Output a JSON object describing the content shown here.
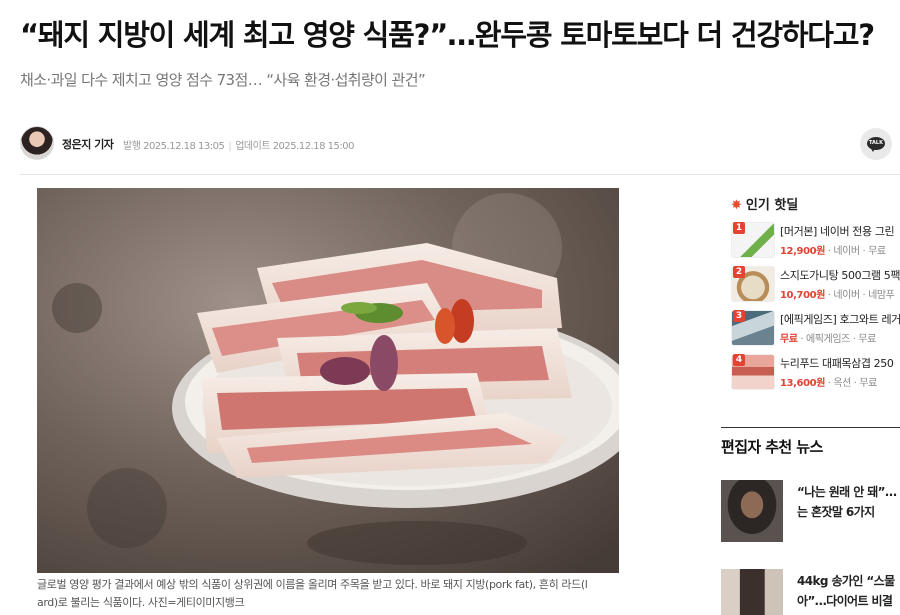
{
  "article": {
    "headline": "“돼지 지방이 세계 최고 영양 식품?”…완두콩 토마토보다 더 건강하다고?",
    "subheadline": "채소·과일 다수 제치고 영양 점수 73점… “사육 환경·섭취량이 관건”",
    "reporter": "정은지 기자",
    "published": "발행 2025.12.18 13:05",
    "updated": "업데이트 2025.12.18 15:00",
    "share_icon": "kakaotalk-icon",
    "share_label": "TALK",
    "photo_caption_line1": "글로벌 영양 평가 결과에서 예상 밖의 식품이 상위권에 이름을 올리며 주목을 받고 있다. 바로 돼지 지방(pork fat), 흔히 라드(l",
    "photo_caption_line2": "ard)로 불리는 식품이다. 사진=게티이미지뱅크"
  },
  "popular": {
    "icon": "fire-icon",
    "title": "인기 핫딜",
    "items": [
      {
        "rank": "1",
        "title": "[머거본] 네이버 전용 그린",
        "price": "12,900원",
        "meta": " · 네이버 · 무료"
      },
      {
        "rank": "2",
        "title": "스지도가니탕 500그램 5팩",
        "price": "10,700원",
        "meta": " · 네이버 · 네맘푸",
        "pad": ""
      },
      {
        "rank": "3",
        "title": "[에픽게임즈] 호그와트 레거",
        "price": "무료",
        "meta": " · 에픽게임즈 · 무료"
      },
      {
        "rank": "4",
        "title": "누리푸드 대패목삼겹 250",
        "price": "13,600원",
        "meta": " · 옥션 · 무료"
      }
    ]
  },
  "editor_picks": {
    "title": "편집자 추천 뉴스",
    "items": [
      {
        "line1": "“나는 원래 안 돼”…",
        "line2": "는 혼잣말 6가지"
      },
      {
        "line1": "44kg 송가인 “스물",
        "line2": "아”…다이어트 비결"
      }
    ]
  },
  "colors": {
    "accent": "#e24333",
    "headline": "#111111",
    "muted": "#777777"
  }
}
